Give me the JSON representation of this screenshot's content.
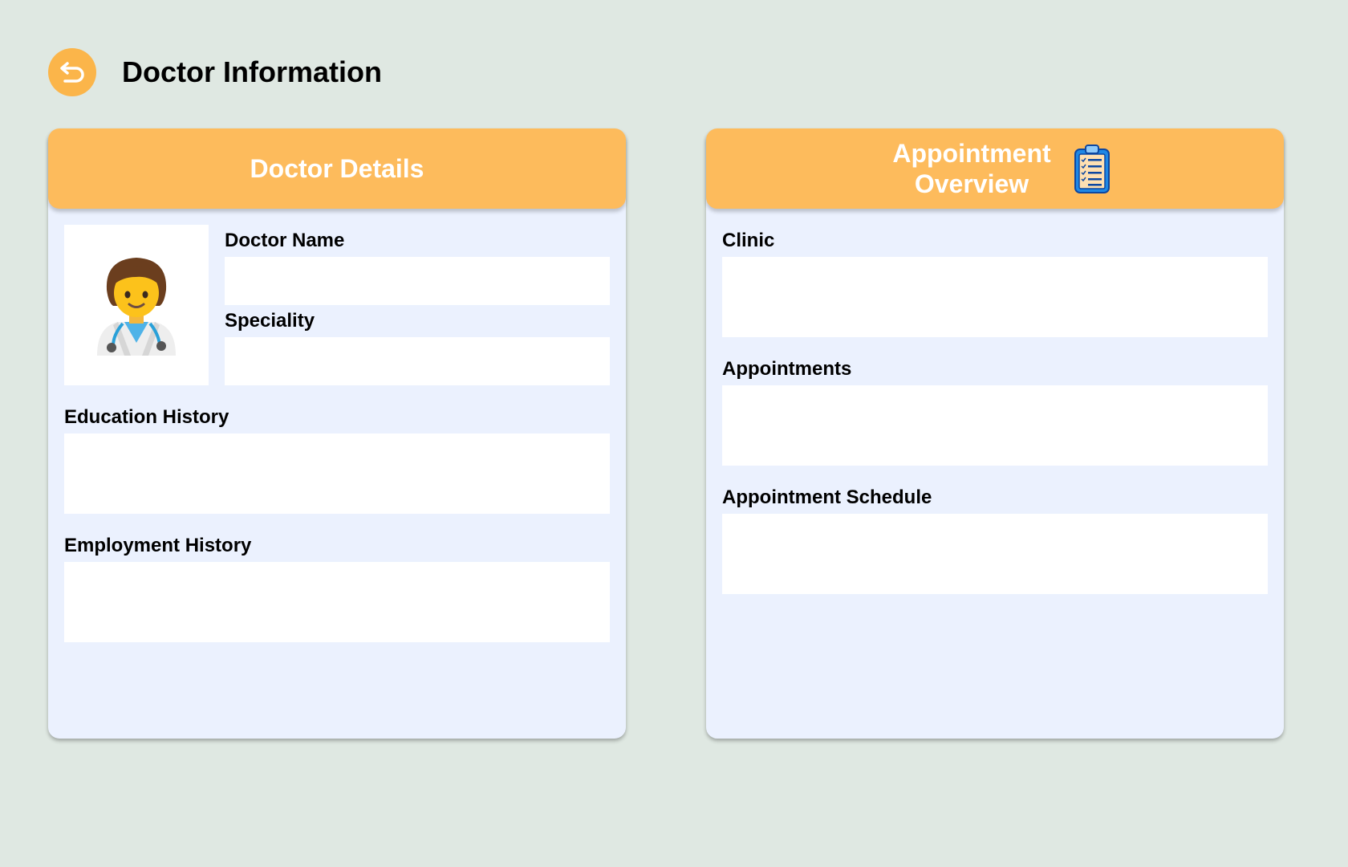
{
  "page": {
    "title": "Doctor Information",
    "back_icon": "back-arrow-icon"
  },
  "doctor_details": {
    "title": "Doctor Details",
    "avatar_icon": "doctor-avatar-icon",
    "fields": {
      "doctor_name": {
        "label": "Doctor Name",
        "value": ""
      },
      "speciality": {
        "label": "Speciality",
        "value": ""
      },
      "education_history": {
        "label": "Education History",
        "value": ""
      },
      "employment_history": {
        "label": "Employment History",
        "value": ""
      }
    }
  },
  "appointment_overview": {
    "title": "Appointment Overview",
    "icon": "clipboard-icon",
    "fields": {
      "clinic": {
        "label": "Clinic",
        "value": ""
      },
      "appointments": {
        "label": "Appointments",
        "value": ""
      },
      "appointment_schedule": {
        "label": "Appointment Schedule",
        "value": ""
      }
    }
  },
  "colors": {
    "background": "#dfe8e2",
    "accent": "#fdbb5c",
    "card_body": "#ebf1fe",
    "field": "#ffffff"
  }
}
